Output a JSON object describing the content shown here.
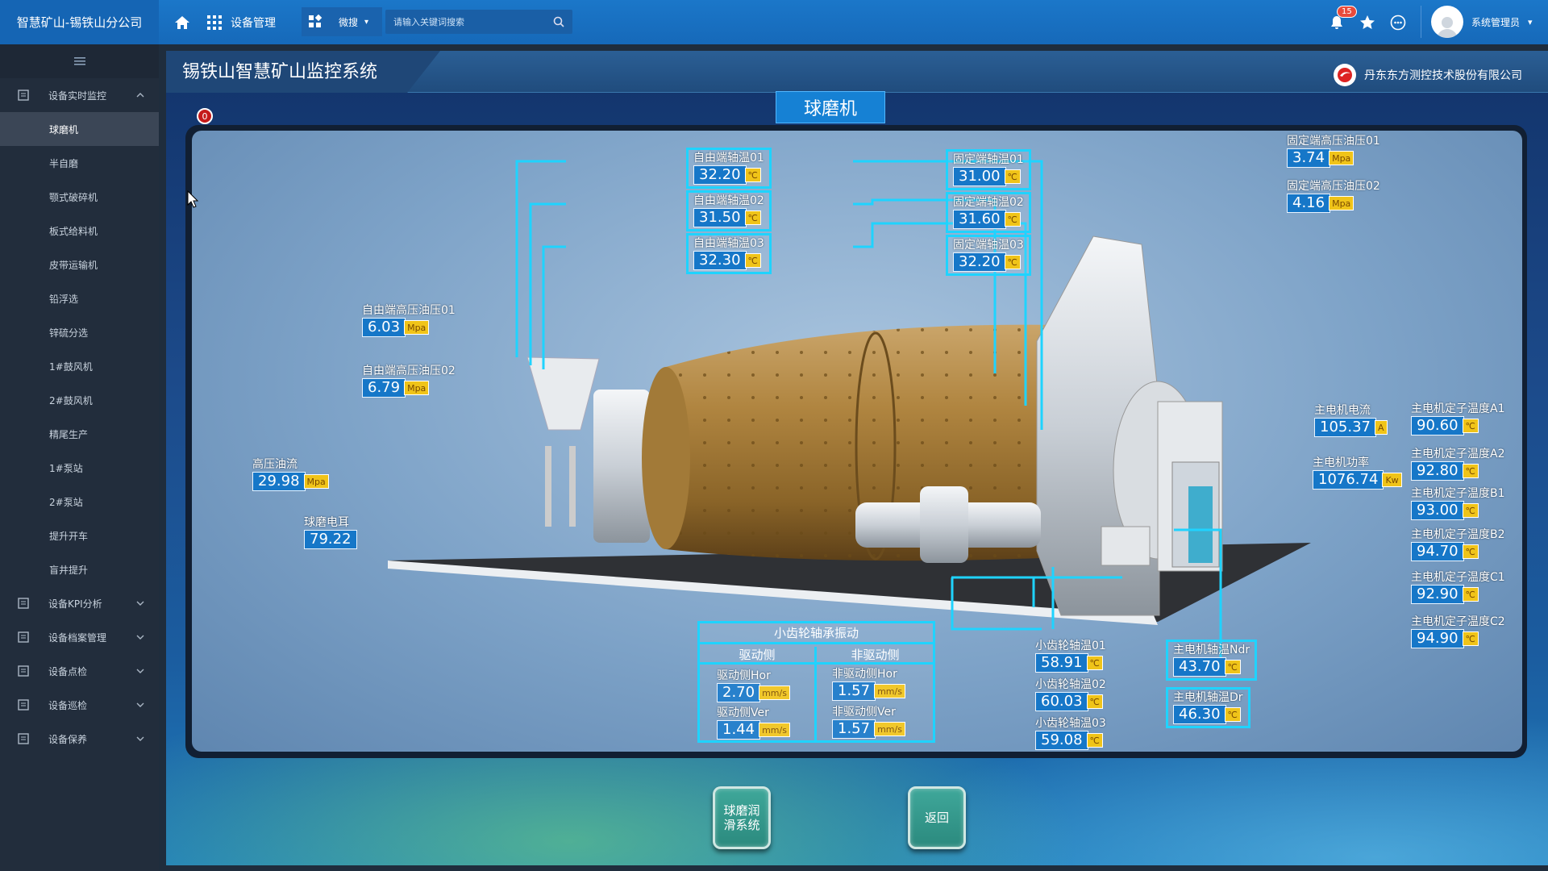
{
  "topbar": {
    "brand": "智慧矿山-锡铁山分公司",
    "module": "设备管理",
    "micro_search": "微搜",
    "search_placeholder": "请输入关键词搜索",
    "notification_count": "15",
    "user": "系统管理员"
  },
  "sidebar": {
    "groups": [
      {
        "label": "设备实时监控",
        "items": [
          "球磨机",
          "半自磨",
          "颚式破碎机",
          "板式给料机",
          "皮带运输机",
          "铅浮选",
          "锌硫分选",
          "1#鼓风机",
          "2#鼓风机",
          "精尾生产",
          "1#泵站",
          "2#泵站",
          "提升开车",
          "盲井提升"
        ]
      },
      {
        "label": "设备KPI分析"
      },
      {
        "label": "设备档案管理"
      },
      {
        "label": "设备点检"
      },
      {
        "label": "设备巡检"
      },
      {
        "label": "设备保养"
      }
    ]
  },
  "main": {
    "system_title": "锡铁山智慧矿山监控系统",
    "company": "丹东东方测控技术股份有限公司",
    "equipment": "球磨机",
    "alarm_count": "0",
    "free_end": [
      {
        "label": "自由端轴温01",
        "value": "32.20",
        "unit": "℃"
      },
      {
        "label": "自由端轴温02",
        "value": "31.50",
        "unit": "℃"
      },
      {
        "label": "自由端轴温03",
        "value": "32.30",
        "unit": "℃"
      }
    ],
    "fixed_end": [
      {
        "label": "固定端轴温01",
        "value": "31.00",
        "unit": "℃"
      },
      {
        "label": "固定端轴温02",
        "value": "31.60",
        "unit": "℃"
      },
      {
        "label": "固定端轴温03",
        "value": "32.20",
        "unit": "℃"
      }
    ],
    "fixed_hp": [
      {
        "label": "固定端高压油压01",
        "value": "3.74",
        "unit": "Mpa"
      },
      {
        "label": "固定端高压油压02",
        "value": "4.16",
        "unit": "Mpa"
      }
    ],
    "free_hp": [
      {
        "label": "自由端高压油压01",
        "value": "6.03",
        "unit": "Mpa"
      },
      {
        "label": "自由端高压油压02",
        "value": "6.79",
        "unit": "Mpa"
      }
    ],
    "hp_flow": {
      "label": "高压油流",
      "value": "29.98",
      "unit": "Mpa"
    },
    "ear": {
      "label": "球磨电耳",
      "value": "79.22"
    },
    "motor_current": {
      "label": "主电机电流",
      "value": "105.37",
      "unit": "A"
    },
    "motor_power": {
      "label": "主电机功率",
      "value": "1076.74",
      "unit": "Kw"
    },
    "stator": [
      {
        "label": "主电机定子温度A1",
        "value": "90.60",
        "unit": "℃"
      },
      {
        "label": "主电机定子温度A2",
        "value": "92.80",
        "unit": "℃"
      },
      {
        "label": "主电机定子温度B1",
        "value": "93.00",
        "unit": "℃"
      },
      {
        "label": "主电机定子温度B2",
        "value": "94.70",
        "unit": "℃"
      },
      {
        "label": "主电机定子温度C1",
        "value": "92.90",
        "unit": "℃"
      },
      {
        "label": "主电机定子温度C2",
        "value": "94.90",
        "unit": "℃"
      }
    ],
    "pinion": [
      {
        "label": "小齿轮轴温01",
        "value": "58.91",
        "unit": "℃"
      },
      {
        "label": "小齿轮轴温02",
        "value": "60.03",
        "unit": "℃"
      },
      {
        "label": "小齿轮轴温03",
        "value": "59.08",
        "unit": "℃"
      }
    ],
    "motor_bearing": [
      {
        "label": "主电机轴温Ndr",
        "value": "43.70",
        "unit": "℃"
      },
      {
        "label": "主电机轴温Dr",
        "value": "46.30",
        "unit": "℃"
      }
    ],
    "vibration": {
      "title": "小齿轮轴承振动",
      "drive": "驱动侧",
      "nondrive": "非驱动侧",
      "items": [
        {
          "label": "驱动侧Hor",
          "value": "2.70",
          "unit": "mm/s"
        },
        {
          "label": "驱动侧Ver",
          "value": "1.44",
          "unit": "mm/s"
        },
        {
          "label": "非驱动侧Hor",
          "value": "1.57",
          "unit": "mm/s"
        },
        {
          "label": "非驱动侧Ver",
          "value": "1.57",
          "unit": "mm/s"
        }
      ]
    },
    "btn_lube": "球磨润\n滑系统",
    "btn_back": "返回"
  },
  "colors": {
    "topbar": "#1b77c9",
    "sidebar": "#222d3c",
    "value_bg": "#1677c8",
    "unit_bg": "#f0c419",
    "highlight": "#1fd3ff"
  }
}
